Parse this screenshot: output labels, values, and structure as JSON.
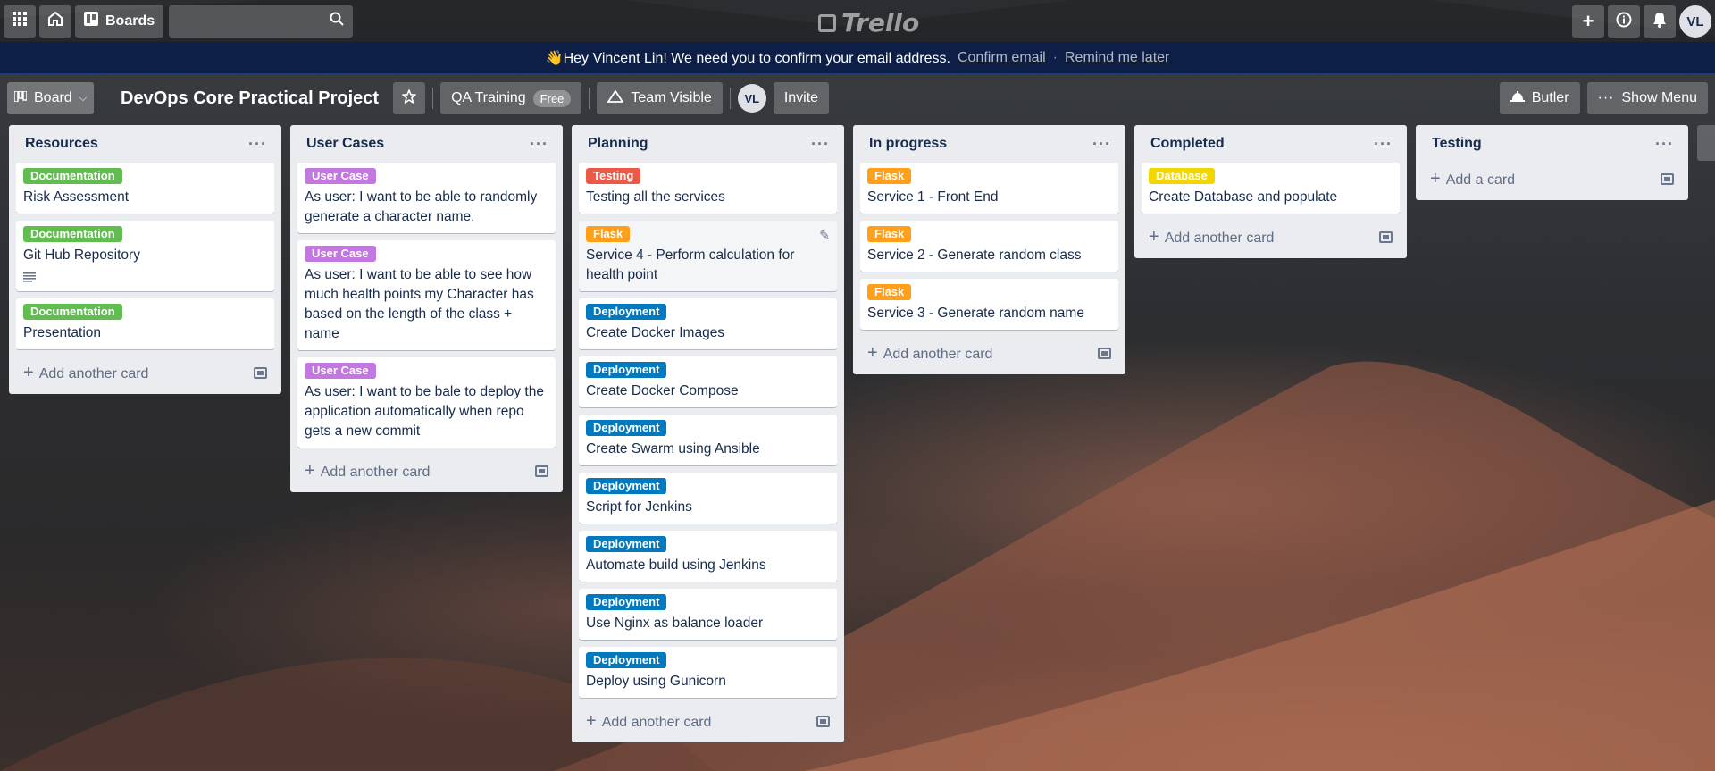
{
  "topbar": {
    "boards_label": "Boards",
    "search_placeholder": "",
    "logo_text": "Trello",
    "avatar_initials": "VL"
  },
  "banner": {
    "message": "👋Hey Vincent Lin! We need you to confirm your email address.",
    "confirm_link": "Confirm email",
    "separator": "·",
    "remind_link": "Remind me later"
  },
  "board_header": {
    "view_label": "Board",
    "title": "DevOps Core Practical Project",
    "workspace_label": "QA Training",
    "workspace_badge": "Free",
    "visibility_label": "Team Visible",
    "member_initials": "VL",
    "invite_label": "Invite",
    "butler_label": "Butler",
    "show_menu_label": "Show Menu"
  },
  "colors": {
    "documentation": "#61bd4f",
    "user_case": "#c377e0",
    "testing": "#eb5a46",
    "flask": "#ff9f1a",
    "deployment": "#0079bf",
    "database": "#f2d600",
    "banner": "#0e1f47"
  },
  "lists": [
    {
      "title": "Resources",
      "cards": [
        {
          "label": "Documentation",
          "label_color": "#61bd4f",
          "title": "Risk Assessment"
        },
        {
          "label": "Documentation",
          "label_color": "#61bd4f",
          "title": "Git Hub Repository",
          "has_description": true
        },
        {
          "label": "Documentation",
          "label_color": "#61bd4f",
          "title": "Presentation"
        }
      ],
      "add_label": "Add another card"
    },
    {
      "title": "User Cases",
      "cards": [
        {
          "label": "User Case",
          "label_color": "#c377e0",
          "title": "As user: I want to be able to randomly generate a character name."
        },
        {
          "label": "User Case",
          "label_color": "#c377e0",
          "title": "As user: I want to be able to see how much health points my Character has based on the length of the class + name"
        },
        {
          "label": "User Case",
          "label_color": "#c377e0",
          "title": "As user: I want to be bale to deploy the application automatically when repo gets a new commit"
        }
      ],
      "add_label": "Add another card"
    },
    {
      "title": "Planning",
      "cards": [
        {
          "label": "Testing",
          "label_color": "#eb5a46",
          "title": "Testing all the services"
        },
        {
          "label": "Flask",
          "label_color": "#ff9f1a",
          "title": "Service 4 - Perform calculation for health point",
          "hovered": true
        },
        {
          "label": "Deployment",
          "label_color": "#0079bf",
          "title": "Create Docker Images"
        },
        {
          "label": "Deployment",
          "label_color": "#0079bf",
          "title": "Create Docker Compose"
        },
        {
          "label": "Deployment",
          "label_color": "#0079bf",
          "title": "Create Swarm using Ansible"
        },
        {
          "label": "Deployment",
          "label_color": "#0079bf",
          "title": "Script for Jenkins"
        },
        {
          "label": "Deployment",
          "label_color": "#0079bf",
          "title": "Automate build using Jenkins"
        },
        {
          "label": "Deployment",
          "label_color": "#0079bf",
          "title": "Use Nginx as balance loader"
        },
        {
          "label": "Deployment",
          "label_color": "#0079bf",
          "title": "Deploy using Gunicorn"
        }
      ],
      "add_label": "Add another card"
    },
    {
      "title": "In progress",
      "cards": [
        {
          "label": "Flask",
          "label_color": "#ff9f1a",
          "title": "Service 1 - Front End"
        },
        {
          "label": "Flask",
          "label_color": "#ff9f1a",
          "title": "Service 2 - Generate random class"
        },
        {
          "label": "Flask",
          "label_color": "#ff9f1a",
          "title": "Service 3 - Generate random name"
        }
      ],
      "add_label": "Add another card"
    },
    {
      "title": "Completed",
      "cards": [
        {
          "label": "Database",
          "label_color": "#f2d600",
          "title": "Create Database and populate"
        }
      ],
      "add_label": "Add another card"
    },
    {
      "title": "Testing",
      "cards": [],
      "add_label": "Add a card"
    }
  ]
}
